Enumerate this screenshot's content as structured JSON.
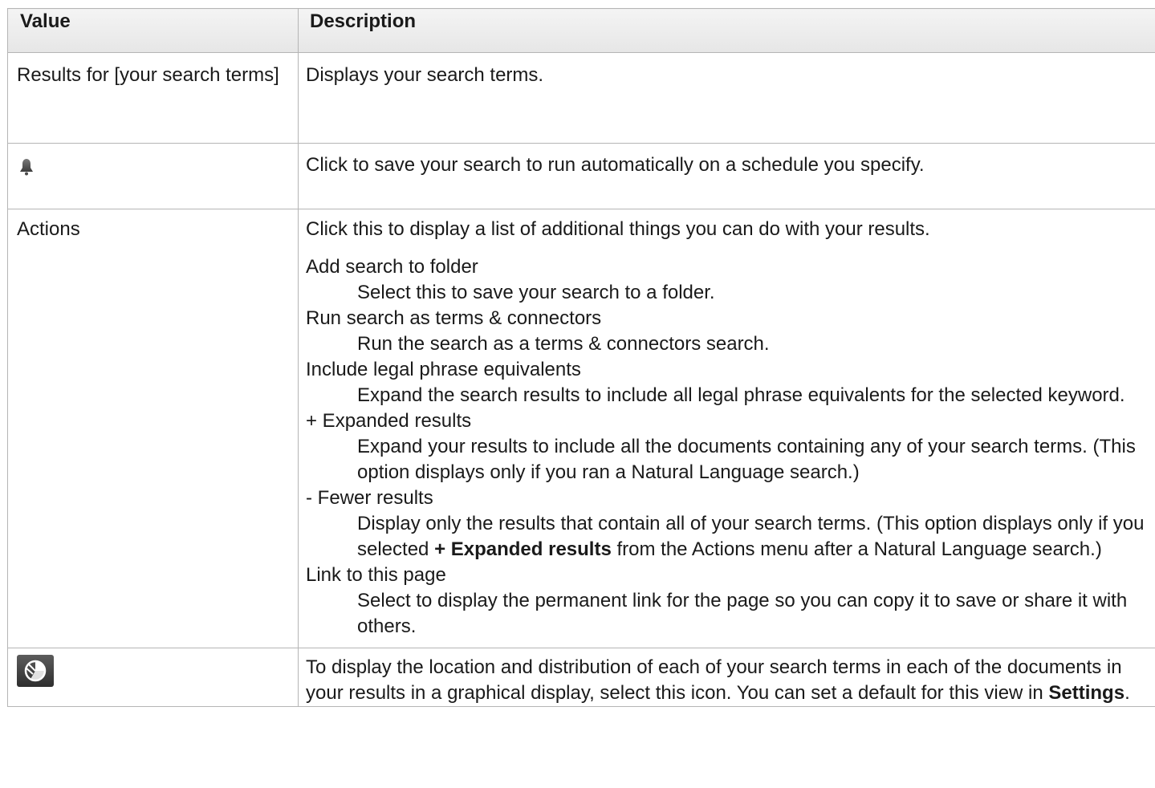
{
  "headers": {
    "value": "Value",
    "description": "Description"
  },
  "rows": {
    "results": {
      "value": "Results for [your search terms]",
      "description": "Displays your search terms."
    },
    "alert": {
      "icon": "bell-icon",
      "description": "Click to save your search to run automatically on a schedule you specify."
    },
    "actions": {
      "value": "Actions",
      "intro": "Click this to display a list of additional things you can do with your results.",
      "items": [
        {
          "term": "Add search to folder",
          "def": "Select this to save your search to a folder."
        },
        {
          "term": "Run search as terms & connectors",
          "def": "Run the search as a terms & connectors search."
        },
        {
          "term": "Include legal phrase equivalents",
          "def": "Expand the search results to include all legal phrase equivalents for the selected keyword."
        },
        {
          "term": "+ Expanded results",
          "def": "Expand your results to include all the documents containing any of your search terms. (This option displays only if you ran a Natural Language search.)"
        },
        {
          "term": "- Fewer results",
          "def_pre": "Display only the results that contain all of your search terms. (This option displays only if you selected ",
          "def_bold": "+ Expanded results",
          "def_post": "  from the Actions menu after a Natural Language search.)"
        },
        {
          "term": "Link to this page",
          "def": "Select to display the permanent link for the page so you can copy it to save or share it with others."
        }
      ]
    },
    "term_map": {
      "icon": "pie-chart-icon",
      "description_pre": "To display the location and distribution of each of your search terms in each of the documents in your results in a graphical display, select this icon. You can set a default for this view in ",
      "description_bold": "Settings",
      "description_post": "."
    }
  }
}
